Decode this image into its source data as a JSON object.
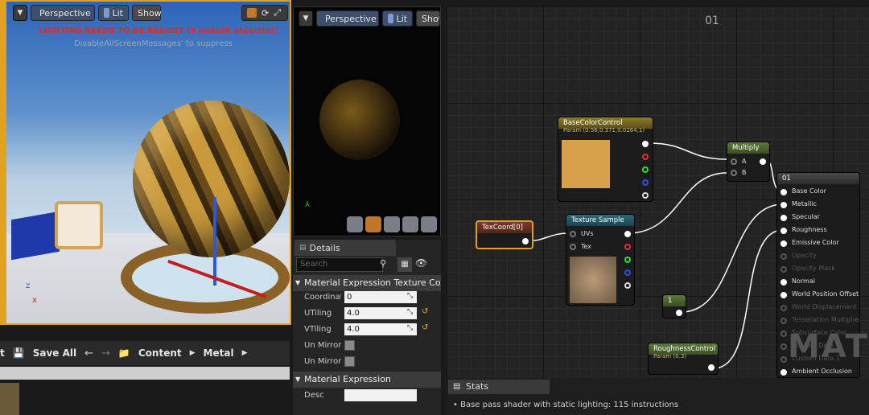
{
  "viewport_main": {
    "perspective_label": "Perspective",
    "lit_label": "Lit",
    "show_label": "Show",
    "warning_text": "LIGHTING NEEDS TO BE REBUILT (9 unbuilt object(s))",
    "suppress_text": "DisableAllScreenMessages' to suppress"
  },
  "viewport_preview": {
    "perspective_label": "Perspective",
    "lit_label": "Lit",
    "show_label": "Show"
  },
  "content_bar": {
    "save_all_label": "Save All",
    "breadcrumbs": [
      "Content",
      "Metal"
    ]
  },
  "details": {
    "tab_label": "Details",
    "search_placeholder": "Search",
    "section1_title": "Material Expression Texture Coo",
    "props": [
      {
        "label": "Coordinate",
        "value": "0"
      },
      {
        "label": "UTiling",
        "value": "4.0"
      },
      {
        "label": "VTiling",
        "value": "4.0"
      }
    ],
    "checks": [
      {
        "label": "Un Mirror U"
      },
      {
        "label": "Un Mirror V"
      }
    ],
    "section2_title": "Material Expression",
    "desc_label": "Desc"
  },
  "graph": {
    "title": "01",
    "nodes": {
      "basecolor": {
        "title": "BaseColorControl",
        "sub": "Param (0.56,0.371,0.0264,1)",
        "color": "#d8a04a"
      },
      "multiply": {
        "title": "Multiply",
        "pin_a": "A",
        "pin_b": "B"
      },
      "texcoord": {
        "title": "TexCoord[0]"
      },
      "texsample": {
        "title": "Texture Sample",
        "pin_uvs": "UVs",
        "pin_tex": "Tex"
      },
      "constant": {
        "title": "1"
      },
      "roughness": {
        "title": "RoughnessControl",
        "sub": "Param (0.3)"
      },
      "result": {
        "title": "01",
        "pins": [
          {
            "label": "Base Color",
            "active": true
          },
          {
            "label": "Metallic",
            "active": true
          },
          {
            "label": "Specular",
            "active": true
          },
          {
            "label": "Roughness",
            "active": true
          },
          {
            "label": "Emissive Color",
            "active": true
          },
          {
            "label": "Opacity",
            "active": false
          },
          {
            "label": "Opacity Mask",
            "active": false
          },
          {
            "label": "Normal",
            "active": true
          },
          {
            "label": "World Position Offset",
            "active": true
          },
          {
            "label": "World Displacement",
            "active": false
          },
          {
            "label": "Tessellation Multiplier",
            "active": false
          },
          {
            "label": "Subsurface Color",
            "active": false
          },
          {
            "label": "Custom Data 0",
            "active": false
          },
          {
            "label": "Custom Data 1",
            "active": false
          },
          {
            "label": "Ambient Occlusion",
            "active": true
          }
        ]
      }
    },
    "watermark": "MAT"
  },
  "stats": {
    "tab_label": "Stats",
    "line": "Base pass shader with static lighting: 115 instructions"
  }
}
